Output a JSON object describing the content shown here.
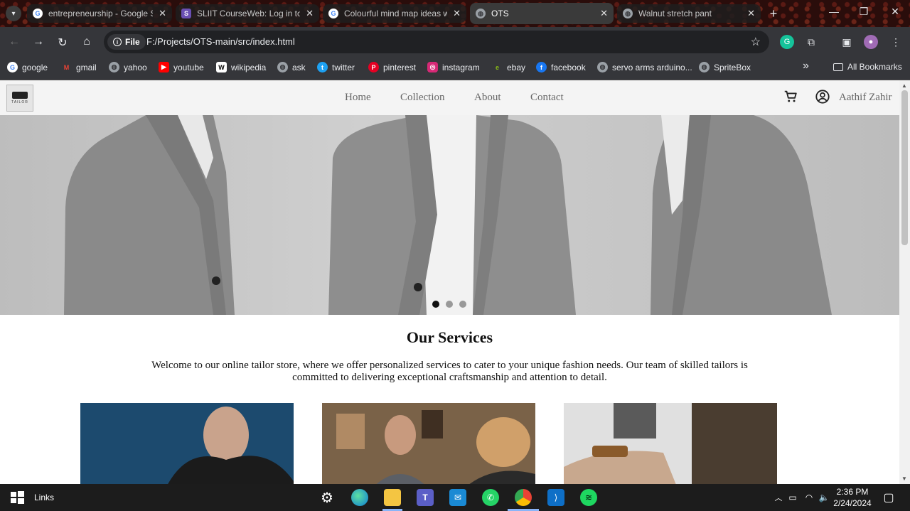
{
  "browser": {
    "tabs": [
      {
        "title": "entrepreneurship - Google S",
        "icon": "google-icon",
        "active": false
      },
      {
        "title": "SLIIT CourseWeb: Log in to t",
        "icon": "sliit-icon",
        "active": false
      },
      {
        "title": "Colourful mind map ideas w",
        "icon": "google-icon",
        "active": false
      },
      {
        "title": "OTS",
        "icon": "globe-icon",
        "active": true
      },
      {
        "title": "Walnut stretch pant",
        "icon": "globe-icon",
        "active": false
      }
    ],
    "new_tab": "+",
    "address_chip": "File",
    "url": "F:/Projects/OTS-main/src/index.html",
    "bookmarks": [
      {
        "label": "google",
        "icon": "google-icon"
      },
      {
        "label": "gmail",
        "icon": "gmail-icon"
      },
      {
        "label": "yahoo",
        "icon": "globe-icon"
      },
      {
        "label": "youtube",
        "icon": "youtube-icon"
      },
      {
        "label": "wikipedia",
        "icon": "wikipedia-icon"
      },
      {
        "label": "ask",
        "icon": "globe-icon"
      },
      {
        "label": "twitter",
        "icon": "twitter-icon"
      },
      {
        "label": "pinterest",
        "icon": "pinterest-icon"
      },
      {
        "label": "instagram",
        "icon": "instagram-icon"
      },
      {
        "label": "ebay",
        "icon": "ebay-icon"
      },
      {
        "label": "facebook",
        "icon": "facebook-icon"
      },
      {
        "label": "servo arms arduino...",
        "icon": "globe-icon"
      },
      {
        "label": "SpriteBox",
        "icon": "globe-icon"
      }
    ],
    "all_bookmarks": "All Bookmarks",
    "more_bookmarks": "»"
  },
  "site": {
    "nav": [
      "Home",
      "Collection",
      "About",
      "Contact"
    ],
    "user_name": "Aathif Zahir",
    "logo_text": "TAILOR"
  },
  "hero": {
    "slides": 3,
    "active_slide": 1
  },
  "services": {
    "title": "Our Services",
    "description": "Welcome to our online tailor store, where we offer personalized services to cater to your unique fashion needs. Our team of skilled tailors is committed to delivering exceptional craftsmanship and attention to detail."
  },
  "taskbar": {
    "links_label": "Links",
    "time": "2:36 PM",
    "date": "2/24/2024"
  },
  "colors": {
    "accent": "#8ab4f8",
    "page_bg": "#ffffff",
    "header_bg": "#f4f4f4"
  }
}
